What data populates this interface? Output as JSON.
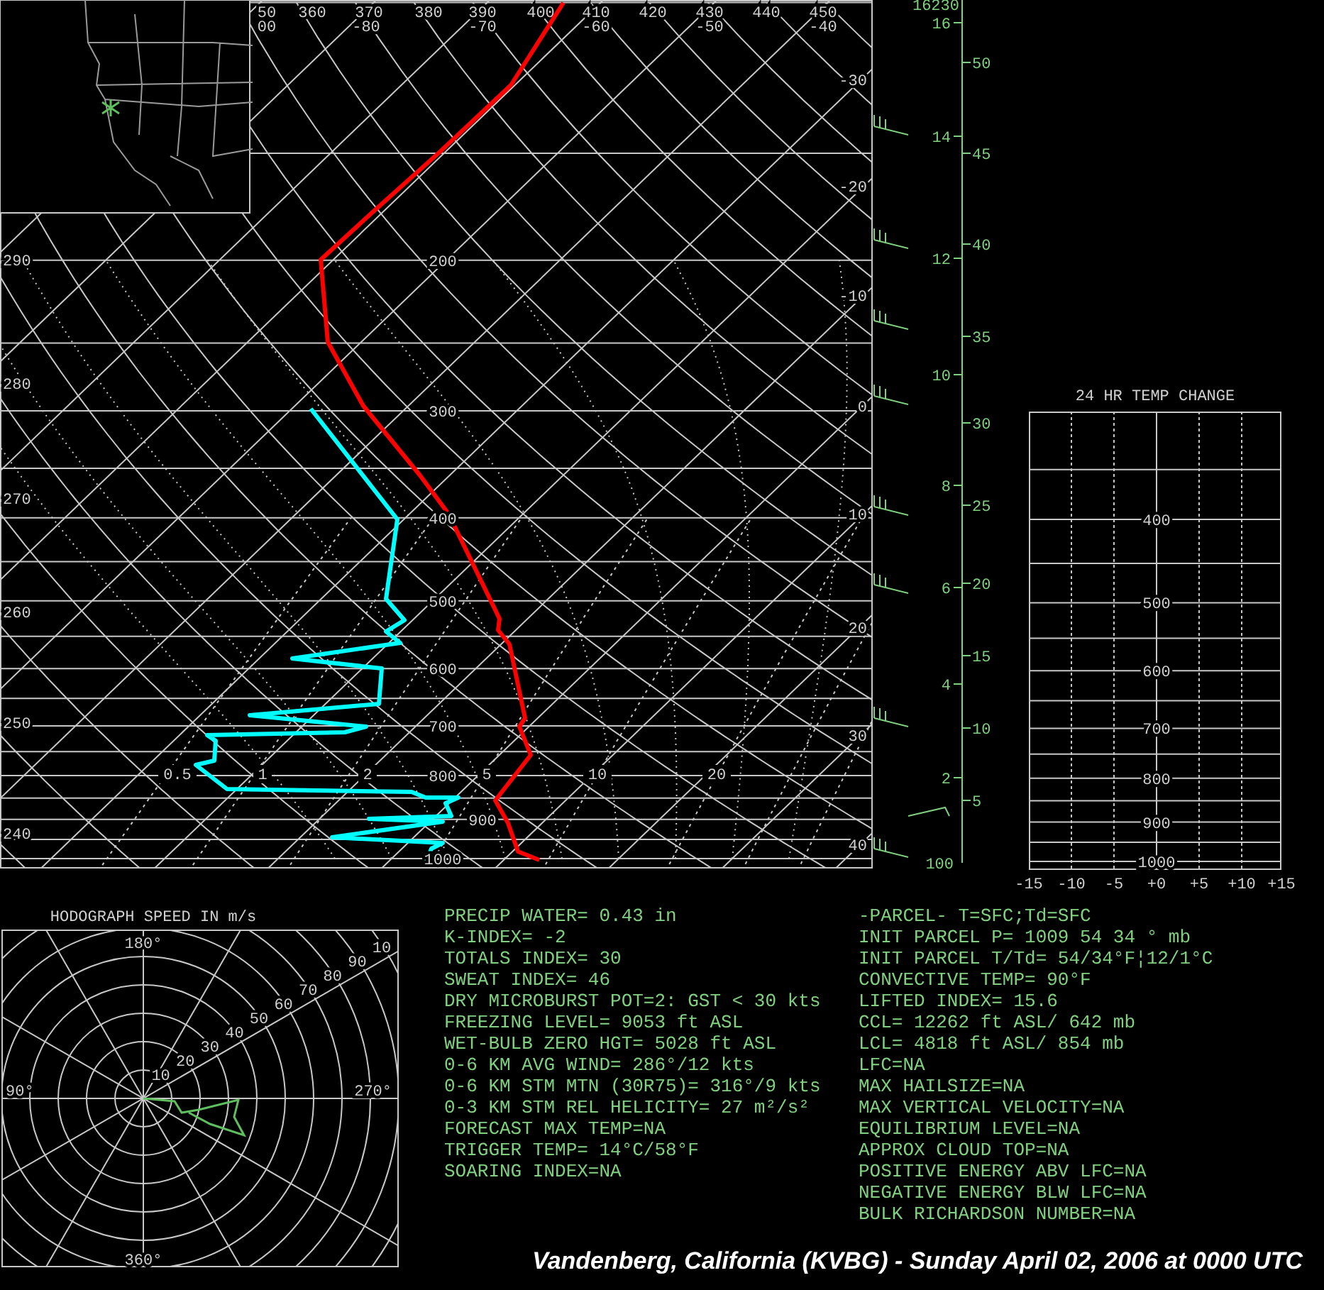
{
  "skew_t": {
    "theta_top_labels": [
      "50",
      "360",
      "370",
      "380",
      "390",
      "400",
      "410",
      "420",
      "430",
      "440",
      "450"
    ],
    "temperature_top_labels": [
      "00",
      "-80",
      "-70",
      "-60",
      "-50",
      "-40"
    ],
    "theta_left_labels": [
      "290",
      "280",
      "270",
      "260",
      "250",
      "240"
    ],
    "temperature_right_labels": [
      "-30",
      "-20",
      "-10",
      "0",
      "10",
      "20",
      "30",
      "40"
    ],
    "pressure_labels": [
      "200",
      "300",
      "400",
      "500",
      "600",
      "700",
      "800",
      "900",
      "1000"
    ],
    "mixing_ratio_labels": [
      "0.5",
      "1",
      "2",
      "5",
      "10",
      "20"
    ],
    "height_km_labels": [
      "16",
      "14",
      "12",
      "10",
      "8",
      "6",
      "4",
      "2"
    ],
    "height_kft_labels": [
      "50",
      "45",
      "40",
      "35",
      "30",
      "25",
      "20",
      "15",
      "10",
      "5"
    ],
    "top_height_label": "16230",
    "bottom_axis_label": "100"
  },
  "temp_change": {
    "title": "24 HR TEMP CHANGE",
    "pressure_labels": [
      "400",
      "500",
      "600",
      "700",
      "800",
      "900",
      "1000"
    ],
    "change_labels": [
      "-15",
      "-10",
      "-5",
      "+0",
      "+5",
      "+10",
      "+15"
    ]
  },
  "hodograph": {
    "title": "HODOGRAPH SPEED IN m/s",
    "direction_labels": [
      "180°",
      "90°",
      "270°",
      "360°"
    ],
    "speed_labels": [
      "10",
      "20",
      "30",
      "40",
      "50",
      "60",
      "70",
      "80",
      "90",
      "10"
    ]
  },
  "indices_left": [
    "PRECIP WATER= 0.43 in",
    "K-INDEX= -2",
    "TOTALS INDEX= 30",
    "SWEAT INDEX= 46",
    "DRY MICROBURST POT=2: GST < 30 kts",
    "FREEZING LEVEL= 9053 ft ASL",
    "WET-BULB ZERO HGT= 5028 ft ASL",
    "0-6 KM AVG WIND= 286°/12 kts",
    "0-6 KM STM MTN (30R75)= 316°/9 kts",
    "0-3 KM STM REL HELICITY= 27 m²/s²",
    "FORECAST MAX TEMP=NA",
    "TRIGGER TEMP= 14°C/58°F",
    "SOARING INDEX=NA"
  ],
  "indices_right": [
    "-PARCEL- T=SFC;Td=SFC",
    "INIT PARCEL P= 1009 54 34 ° mb",
    "INIT PARCEL T/Td= 54/34°F¦12/1°C",
    "CONVECTIVE TEMP= 90°F",
    "LIFTED INDEX= 15.6",
    "CCL= 12262 ft ASL/ 642 mb",
    "LCL= 4818 ft ASL/ 854 mb",
    "LFC=NA",
    "MAX HAILSIZE=NA",
    "MAX VERTICAL VELOCITY=NA",
    "EQUILIBRIUM LEVEL=NA",
    "APPROX CLOUD TOP=NA",
    "POSITIVE ENERGY ABV LFC=NA",
    "NEGATIVE ENERGY BLW LFC=NA",
    "BULK RICHARDSON NUMBER=NA"
  ],
  "caption": "Vandenberg, California (KVBG) - Sunday April 02, 2006 at 0000 UTC"
}
